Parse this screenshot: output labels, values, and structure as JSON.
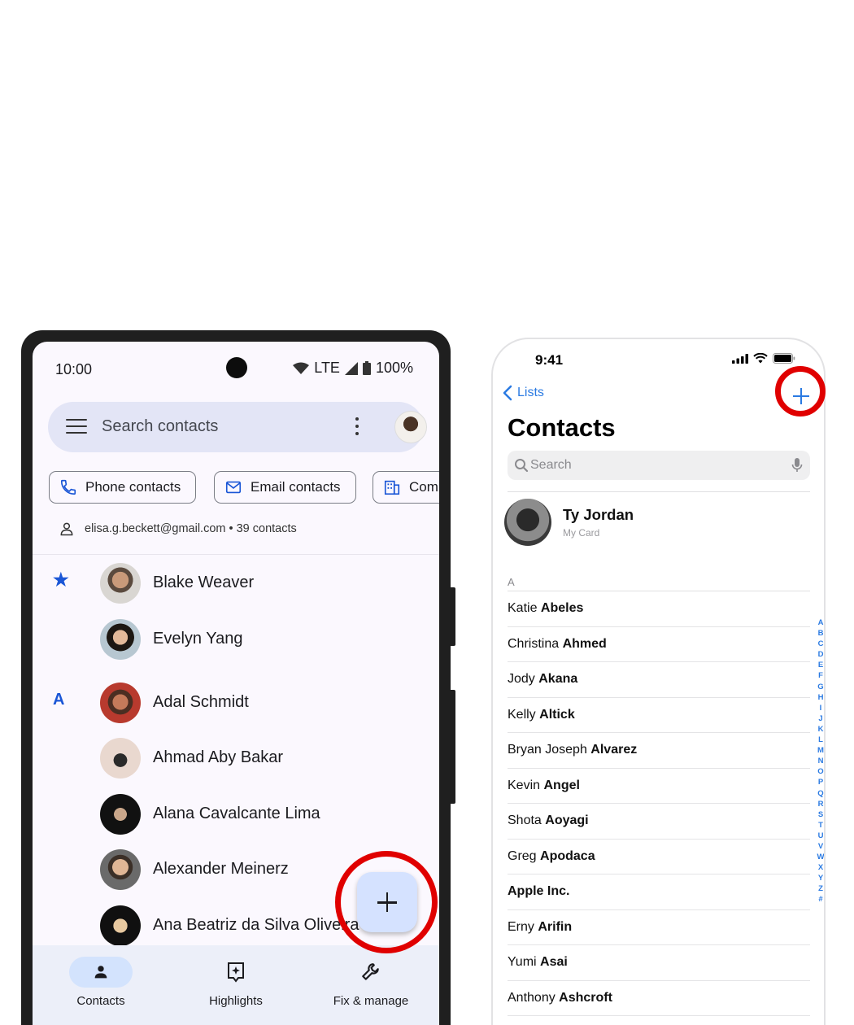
{
  "android": {
    "status": {
      "time": "10:00",
      "network": "LTE",
      "battery": "100%"
    },
    "search_placeholder": "Search contacts",
    "chips": [
      "Phone contacts",
      "Email contacts",
      "Com"
    ],
    "account_line": "elisa.g.beckett@gmail.com • 39 contacts",
    "contacts": [
      {
        "section": "★",
        "name": "Blake Weaver"
      },
      {
        "section": "",
        "name": "Evelyn Yang"
      },
      {
        "section": "A",
        "name": "Adal Schmidt"
      },
      {
        "section": "",
        "name": "Ahmad Aby Bakar"
      },
      {
        "section": "",
        "name": "Alana Cavalcante Lima"
      },
      {
        "section": "",
        "name": "Alexander Meinerz"
      },
      {
        "section": "",
        "name": "Ana Beatriz da Silva Oliveira"
      }
    ],
    "nav": [
      "Contacts",
      "Highlights",
      "Fix & manage"
    ],
    "colors": {
      "accent": "#1a56d6",
      "fab": "#d5e2ff",
      "highlight_ring": "#e00000"
    }
  },
  "ios": {
    "status_time": "9:41",
    "back_label": "Lists",
    "title": "Contacts",
    "search_placeholder": "Search",
    "my_card": {
      "name": "Ty Jordan",
      "subtitle": "My Card"
    },
    "section": "A",
    "contacts": [
      {
        "first": "Katie",
        "last": "Abeles"
      },
      {
        "first": "Christina",
        "last": "Ahmed"
      },
      {
        "first": "Jody",
        "last": "Akana"
      },
      {
        "first": "Kelly",
        "last": "Altick"
      },
      {
        "first": "Bryan Joseph",
        "last": "Alvarez"
      },
      {
        "first": "Kevin",
        "last": "Angel"
      },
      {
        "first": "Shota",
        "last": "Aoyagi"
      },
      {
        "first": "Greg",
        "last": "Apodaca"
      },
      {
        "first": "",
        "last": "Apple Inc."
      },
      {
        "first": "Erny",
        "last": "Arifin"
      },
      {
        "first": "Yumi",
        "last": "Asai"
      },
      {
        "first": "Anthony",
        "last": "Ashcroft"
      }
    ],
    "index_letters": [
      "A",
      "B",
      "C",
      "D",
      "E",
      "F",
      "G",
      "H",
      "I",
      "J",
      "K",
      "L",
      "M",
      "N",
      "O",
      "P",
      "Q",
      "R",
      "S",
      "T",
      "U",
      "V",
      "W",
      "X",
      "Y",
      "Z",
      "#"
    ],
    "colors": {
      "accent": "#2a7ae2"
    }
  }
}
